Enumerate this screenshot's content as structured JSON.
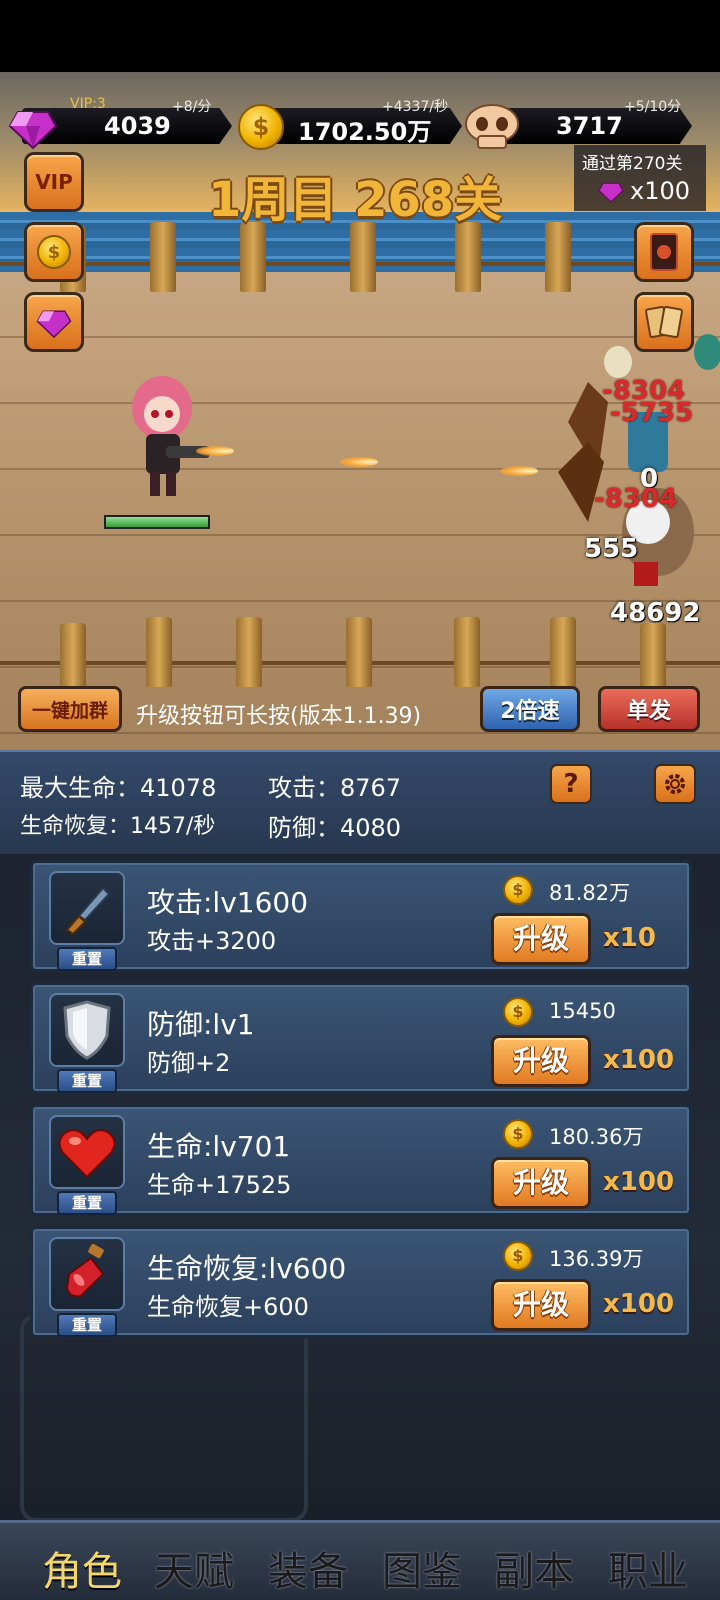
{
  "resources": {
    "gems": {
      "label": "VIP:3",
      "value": "4039",
      "rate": "+8/分"
    },
    "coins": {
      "value": "1702.50万",
      "rate": "+4337/秒"
    },
    "skulls": {
      "value": "3717",
      "rate": "+5/10分"
    }
  },
  "stage": {
    "title": "1周目 268关"
  },
  "reward": {
    "text": "通过第270关",
    "amount": "x100"
  },
  "side_buttons": {
    "vip": "VIP"
  },
  "combat": {
    "damage": [
      {
        "text": "-8304",
        "color": "red"
      },
      {
        "text": "-5735",
        "color": "red"
      },
      {
        "text": "0",
        "color": "white"
      },
      {
        "text": "-8304",
        "color": "red"
      },
      {
        "text": "555",
        "color": "white"
      },
      {
        "text": "48692",
        "color": "white"
      }
    ],
    "hero_hp_fraction": 1.0
  },
  "actions": {
    "join_group": "一键加群",
    "hint": "升级按钮可长按(版本1.1.39)",
    "speed": "2倍速",
    "fire_mode": "单发"
  },
  "stats": {
    "max_hp": "最大生命：41078",
    "attack": "攻击：8767",
    "regen": "生命恢复：1457/秒",
    "defense": "防御：4080",
    "help_icon": "?",
    "settings_icon": "gear-icon"
  },
  "upgrades": [
    {
      "icon": "knife-icon",
      "reset": "重置",
      "name": "攻击:lv1600",
      "bonus": "攻击+3200",
      "cost": "81.82万",
      "button": "升级",
      "multiplier": "x10"
    },
    {
      "icon": "shield-icon",
      "reset": "重置",
      "name": "防御:lv1",
      "bonus": "防御+2",
      "cost": "15450",
      "button": "升级",
      "multiplier": "x100"
    },
    {
      "icon": "heart-icon",
      "reset": "重置",
      "name": "生命:lv701",
      "bonus": "生命+17525",
      "cost": "180.36万",
      "button": "升级",
      "multiplier": "x100"
    },
    {
      "icon": "potion-icon",
      "reset": "重置",
      "name": "生命恢复:lv600",
      "bonus": "生命恢复+600",
      "cost": "136.39万",
      "button": "升级",
      "multiplier": "x100"
    }
  ],
  "nav": {
    "tabs": [
      "角色",
      "天赋",
      "装备",
      "图鉴",
      "副本",
      "职业"
    ],
    "active": "角色"
  },
  "colors": {
    "accent_gold": "#f1b53a",
    "button_orange": "#e07a22",
    "panel_blue": "#2b405c"
  }
}
